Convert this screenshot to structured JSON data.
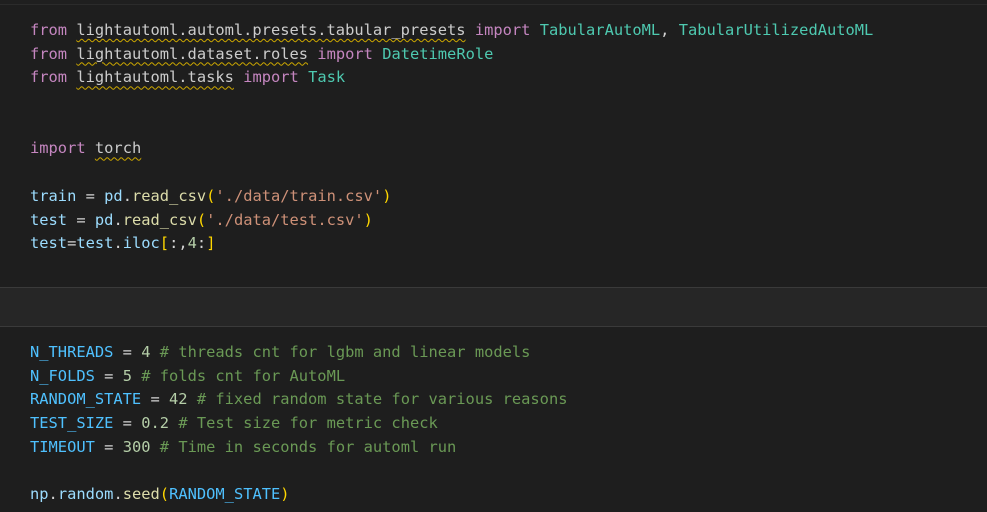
{
  "cells": [
    {
      "lines": [
        {
          "tokens": [
            [
              "kw",
              "from"
            ],
            [
              "op",
              " "
            ],
            [
              "mod squig",
              "lightautoml.automl.presets.tabular_presets"
            ],
            [
              "op",
              " "
            ],
            [
              "kw",
              "import"
            ],
            [
              "op",
              " "
            ],
            [
              "cls",
              "TabularAutoML"
            ],
            [
              "op",
              ", "
            ],
            [
              "cls",
              "TabularUtilizedAutoML"
            ]
          ]
        },
        {
          "tokens": [
            [
              "kw",
              "from"
            ],
            [
              "op",
              " "
            ],
            [
              "mod squig",
              "lightautoml.dataset.roles"
            ],
            [
              "op",
              " "
            ],
            [
              "kw",
              "import"
            ],
            [
              "op",
              " "
            ],
            [
              "cls",
              "DatetimeRole"
            ]
          ]
        },
        {
          "tokens": [
            [
              "kw",
              "from"
            ],
            [
              "op",
              " "
            ],
            [
              "mod squig",
              "lightautoml.tasks"
            ],
            [
              "op",
              " "
            ],
            [
              "kw",
              "import"
            ],
            [
              "op",
              " "
            ],
            [
              "cls",
              "Task"
            ]
          ]
        },
        {
          "tokens": []
        },
        {
          "tokens": []
        },
        {
          "tokens": [
            [
              "kw",
              "import"
            ],
            [
              "op",
              " "
            ],
            [
              "mod squig",
              "torch"
            ]
          ]
        },
        {
          "tokens": []
        },
        {
          "tokens": [
            [
              "ident",
              "train"
            ],
            [
              "op",
              " = "
            ],
            [
              "ident",
              "pd"
            ],
            [
              "op",
              "."
            ],
            [
              "fn",
              "read_csv"
            ],
            [
              "br1",
              "("
            ],
            [
              "str",
              "'./data/train.csv'"
            ],
            [
              "br1",
              ")"
            ]
          ]
        },
        {
          "tokens": [
            [
              "ident",
              "test"
            ],
            [
              "op",
              " = "
            ],
            [
              "ident",
              "pd"
            ],
            [
              "op",
              "."
            ],
            [
              "fn",
              "read_csv"
            ],
            [
              "br1",
              "("
            ],
            [
              "str",
              "'./data/test.csv'"
            ],
            [
              "br1",
              ")"
            ]
          ]
        },
        {
          "tokens": [
            [
              "ident",
              "test"
            ],
            [
              "op",
              "="
            ],
            [
              "ident",
              "test"
            ],
            [
              "op",
              "."
            ],
            [
              "ident",
              "iloc"
            ],
            [
              "br1",
              "["
            ],
            [
              "op",
              ":,"
            ],
            [
              "num",
              "4"
            ],
            [
              "op",
              ":"
            ],
            [
              "br1",
              "]"
            ]
          ]
        }
      ]
    },
    {
      "lines": [
        {
          "tokens": [
            [
              "var",
              "N_THREADS"
            ],
            [
              "op",
              " = "
            ],
            [
              "num",
              "4"
            ],
            [
              "op",
              " "
            ],
            [
              "cmt",
              "# threads cnt for lgbm and linear models"
            ]
          ]
        },
        {
          "tokens": [
            [
              "var",
              "N_FOLDS"
            ],
            [
              "op",
              " = "
            ],
            [
              "num",
              "5"
            ],
            [
              "op",
              " "
            ],
            [
              "cmt",
              "# folds cnt for AutoML"
            ]
          ]
        },
        {
          "tokens": [
            [
              "var",
              "RANDOM_STATE"
            ],
            [
              "op",
              " = "
            ],
            [
              "num",
              "42"
            ],
            [
              "op",
              " "
            ],
            [
              "cmt",
              "# fixed random state for various reasons"
            ]
          ]
        },
        {
          "tokens": [
            [
              "var",
              "TEST_SIZE"
            ],
            [
              "op",
              " = "
            ],
            [
              "num",
              "0.2"
            ],
            [
              "op",
              " "
            ],
            [
              "cmt",
              "# Test size for metric check"
            ]
          ]
        },
        {
          "tokens": [
            [
              "var",
              "TIMEOUT"
            ],
            [
              "op",
              " = "
            ],
            [
              "num",
              "300"
            ],
            [
              "op",
              " "
            ],
            [
              "cmt",
              "# Time in seconds for automl run"
            ]
          ]
        },
        {
          "tokens": []
        },
        {
          "tokens": [
            [
              "ident",
              "np"
            ],
            [
              "op",
              "."
            ],
            [
              "ident",
              "random"
            ],
            [
              "op",
              "."
            ],
            [
              "fn",
              "seed"
            ],
            [
              "br1",
              "("
            ],
            [
              "var",
              "RANDOM_STATE"
            ],
            [
              "br1",
              ")"
            ]
          ]
        }
      ]
    }
  ],
  "colors": {
    "background": "#1e1e1e",
    "keyword": "#c586c0",
    "constant": "#4fc1ff",
    "identifier": "#9cdcfe",
    "function": "#dcdcaa",
    "string": "#ce9178",
    "number": "#b5cea8",
    "comment": "#6a9955",
    "class": "#4ec9b0",
    "bracket": "#ffd700",
    "warning_squiggle": "#cca700"
  }
}
